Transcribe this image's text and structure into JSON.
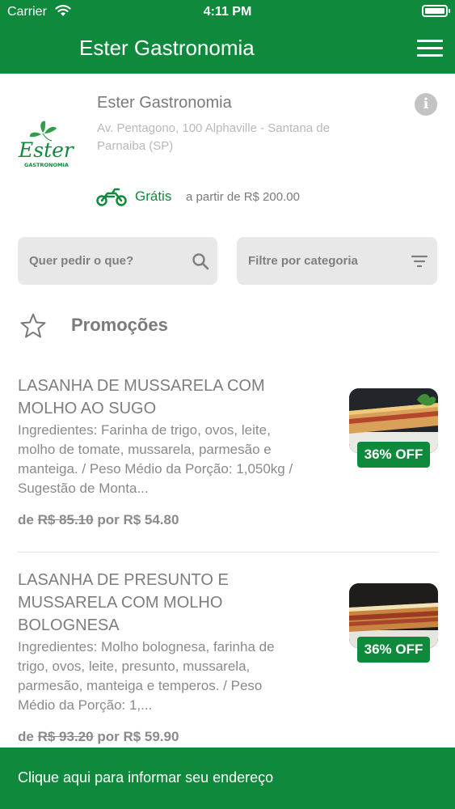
{
  "status_bar": {
    "carrier": "Carrier",
    "time": "4:11 PM"
  },
  "header": {
    "title": "Ester Gastronomia",
    "menu_icon": "hamburger-menu-icon"
  },
  "store": {
    "logo_text": "Ester",
    "logo_subtext": "GASTRONOMIA",
    "name": "Ester Gastronomia",
    "address": "Av. Pentagono, 100 Alphaville - Santana de Parnaiba (SP)",
    "delivery_fee": "Grátis",
    "minimum_order": "a partir de R$ 200.00"
  },
  "search": {
    "placeholder": "Quer pedir o que?",
    "icon": "search-icon"
  },
  "filter": {
    "placeholder": "Filtre por categoria",
    "icon": "filter-icon"
  },
  "section": {
    "title": "Promoções",
    "icon": "star-icon"
  },
  "products": [
    {
      "name": "LASANHA DE MUSSARELA COM MOLHO AO SUGO",
      "description": "Ingredientes: Farinha de trigo, ovos, leite, molho de tomate, mussarela, parmesão e manteiga. / Peso Médio da Porção: 1,050kg / Sugestão de Monta...",
      "price_prefix": "de",
      "old_price": "R$ 85.10",
      "price_mid": "por",
      "new_price": "R$ 54.80",
      "discount": "36% OFF"
    },
    {
      "name": "LASANHA DE PRESUNTO E MUSSARELA COM MOLHO BOLOGNESA",
      "description": "Ingredientes: Molho bolognesa, farinha de trigo, ovos, leite, presunto, mussarela, parmesão, manteiga e temperos. / Peso Médio da Porção: 1,...",
      "price_prefix": "de",
      "old_price": "R$ 93.20",
      "price_mid": "por",
      "new_price": "R$ 59.90",
      "discount": "36% OFF"
    }
  ],
  "footer": {
    "address_prompt": "Clique aqui para informar seu endereço"
  },
  "colors": {
    "brand_green": "#0f8a3c",
    "input_bg": "#e8e8e8"
  }
}
